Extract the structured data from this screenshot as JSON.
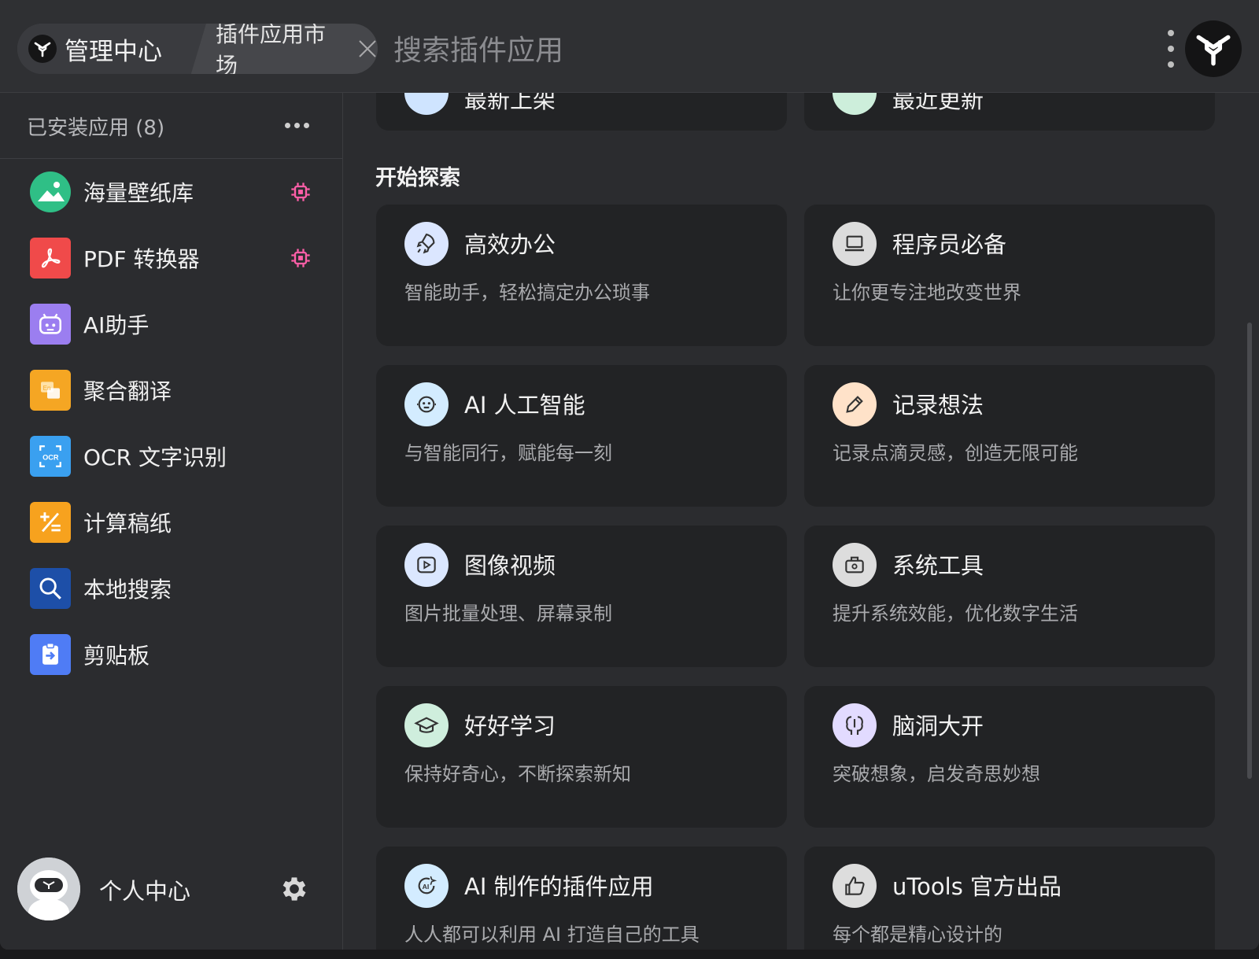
{
  "header": {
    "home_label": "管理中心",
    "market_label": "插件应用市场",
    "search_placeholder": "搜索插件应用"
  },
  "sidebar": {
    "title": "已安装应用 (8)",
    "apps": [
      {
        "name": "海量壁纸库",
        "icon": "wallpaper-icon",
        "color": "#2fbf86",
        "has_badge": true
      },
      {
        "name": "PDF 转换器",
        "icon": "pdf-icon",
        "color": "#f04a4a",
        "has_badge": true
      },
      {
        "name": "AI助手",
        "icon": "robot-icon",
        "color": "#9b7ef0",
        "has_badge": false
      },
      {
        "name": "聚合翻译",
        "icon": "translate-icon",
        "color": "#f5a623",
        "has_badge": false
      },
      {
        "name": "OCR 文字识别",
        "icon": "ocr-icon",
        "color": "#3aa0f0",
        "has_badge": false
      },
      {
        "name": "计算稿纸",
        "icon": "calculator-icon",
        "color": "#f7a21e",
        "has_badge": false
      },
      {
        "name": "本地搜索",
        "icon": "search-icon",
        "color": "#1d4fa8",
        "has_badge": false
      },
      {
        "name": "剪贴板",
        "icon": "clipboard-icon",
        "color": "#4f7cf5",
        "has_badge": false
      }
    ],
    "profile_name": "个人中心"
  },
  "main": {
    "top_partial": [
      "最新上架",
      "最近更新"
    ],
    "section_title": "开始探索",
    "categories": [
      {
        "title": "高效办公",
        "desc": "智能助手，轻松搞定办公琐事",
        "icon": "rocket-icon",
        "bg": "#dbe6ff"
      },
      {
        "title": "程序员必备",
        "desc": "让你更专注地改变世界",
        "icon": "laptop-icon",
        "bg": "#dcdcdc"
      },
      {
        "title": "AI 人工智能",
        "desc": "与智能同行，赋能每一刻",
        "icon": "ai-robot-icon",
        "bg": "#d3ecff"
      },
      {
        "title": "记录想法",
        "desc": "记录点滴灵感，创造无限可能",
        "icon": "pencil-icon",
        "bg": "#ffe2c9"
      },
      {
        "title": "图像视频",
        "desc": "图片批量处理、屏幕录制",
        "icon": "video-play-icon",
        "bg": "#dbe7ff"
      },
      {
        "title": "系统工具",
        "desc": "提升系统效能，优化数字生活",
        "icon": "toolbox-icon",
        "bg": "#dddddd"
      },
      {
        "title": "好好学习",
        "desc": "保持好奇心，不断探索新知",
        "icon": "graduation-cap-icon",
        "bg": "#cfeedd"
      },
      {
        "title": "脑洞大开",
        "desc": "突破想象，启发奇思妙想",
        "icon": "brain-icon",
        "bg": "#e2dbff"
      },
      {
        "title": "AI 制作的插件应用",
        "desc": "人人都可以利用 AI 打造自己的工具",
        "icon": "ai-tool-icon",
        "bg": "#d3ecff"
      },
      {
        "title": "uTools 官方出品",
        "desc": "每个都是精心设计的",
        "icon": "thumbs-up-icon",
        "bg": "#dddddd"
      }
    ]
  }
}
